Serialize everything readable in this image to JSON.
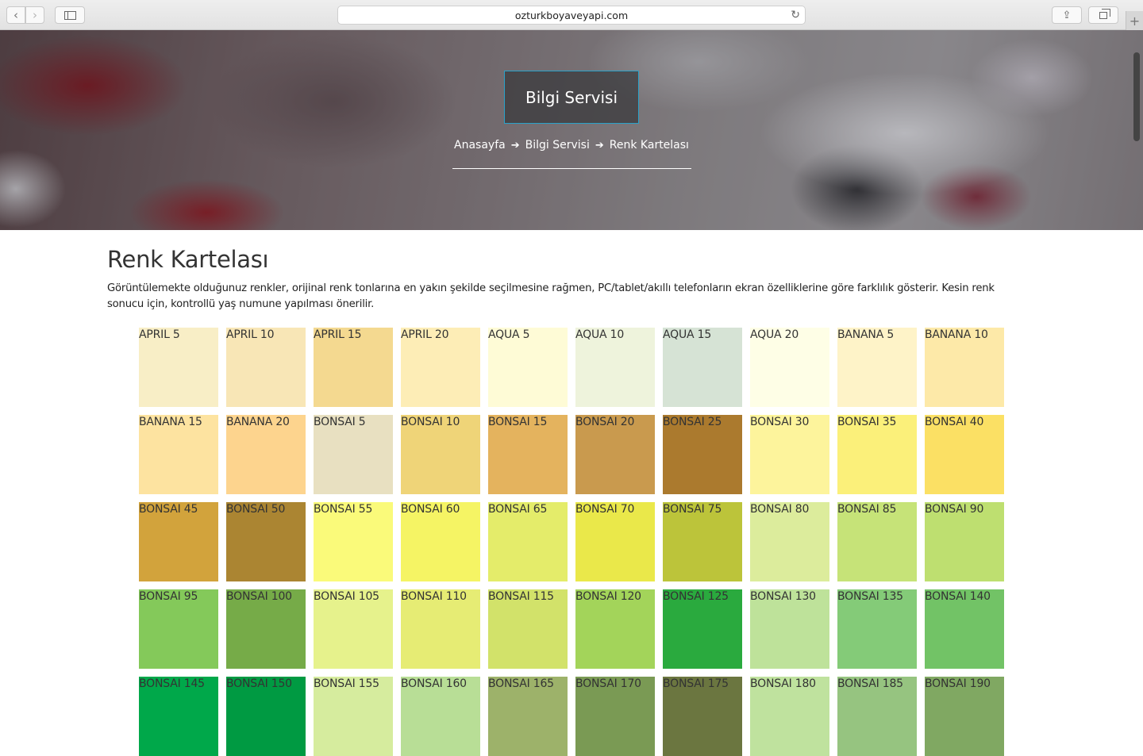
{
  "browser": {
    "url": "ozturkboyaveyapi.com",
    "back_icon": "‹",
    "forward_icon": "›",
    "reload_icon": "↻",
    "share_icon": "⇪",
    "newtab_icon": "+"
  },
  "hero": {
    "title": "Bilgi Servisi",
    "breadcrumb": [
      {
        "label": "Anasayfa"
      },
      {
        "label": "Bilgi Servisi"
      },
      {
        "label": "Renk Kartelası"
      }
    ],
    "separator": "➔"
  },
  "content": {
    "title": "Renk Kartelası",
    "description": "Görüntülemekte olduğunuz renkler, orijinal renk tonlarına en yakın şekilde seçilmesine rağmen, PC/tablet/akıllı telefonların ekran özelliklerine göre farklılık gösterir. Kesin renk sonucu için, kontrollü yaş numune yapılması önerilir."
  },
  "colors": [
    {
      "name": "APRIL 5",
      "hex": "#f8eec6"
    },
    {
      "name": "APRIL 10",
      "hex": "#f8e6b6"
    },
    {
      "name": "APRIL 15",
      "hex": "#f4d990"
    },
    {
      "name": "APRIL 20",
      "hex": "#fdedb6"
    },
    {
      "name": "AQUA 5",
      "hex": "#fefbd6"
    },
    {
      "name": "AQUA 10",
      "hex": "#eef3dc"
    },
    {
      "name": "AQUA 15",
      "hex": "#d6e3d5"
    },
    {
      "name": "AQUA 20",
      "hex": "#fefee6"
    },
    {
      "name": "BANANA 5",
      "hex": "#fef3c8"
    },
    {
      "name": "BANANA 10",
      "hex": "#fde9a8"
    },
    {
      "name": "BANANA 15",
      "hex": "#fde3a0"
    },
    {
      "name": "BANANA 20",
      "hex": "#fdd48e"
    },
    {
      "name": "BONSAI 5",
      "hex": "#e8e0c1"
    },
    {
      "name": "BONSAI 10",
      "hex": "#efd478"
    },
    {
      "name": "BONSAI 15",
      "hex": "#e4b35e"
    },
    {
      "name": "BONSAI 20",
      "hex": "#c99a4e"
    },
    {
      "name": "BONSAI 25",
      "hex": "#ab7a2e"
    },
    {
      "name": "BONSAI 30",
      "hex": "#fdf49c"
    },
    {
      "name": "BONSAI 35",
      "hex": "#fbf07a"
    },
    {
      "name": "BONSAI 40",
      "hex": "#fbe064"
    },
    {
      "name": "BONSAI 45",
      "hex": "#d2a33c"
    },
    {
      "name": "BONSAI 50",
      "hex": "#ab8532"
    },
    {
      "name": "BONSAI 55",
      "hex": "#fafa7a"
    },
    {
      "name": "BONSAI 60",
      "hex": "#f5f464"
    },
    {
      "name": "BONSAI 65",
      "hex": "#e4ec6a"
    },
    {
      "name": "BONSAI 70",
      "hex": "#eae84a"
    },
    {
      "name": "BONSAI 75",
      "hex": "#bcc43a"
    },
    {
      "name": "BONSAI 80",
      "hex": "#dcec9c"
    },
    {
      "name": "BONSAI 85",
      "hex": "#c6e378"
    },
    {
      "name": "BONSAI 90",
      "hex": "#bedf70"
    },
    {
      "name": "BONSAI 95",
      "hex": "#84c95a"
    },
    {
      "name": "BONSAI 100",
      "hex": "#76ab48"
    },
    {
      "name": "BONSAI 105",
      "hex": "#e6f28c"
    },
    {
      "name": "BONSAI 110",
      "hex": "#e6ec74"
    },
    {
      "name": "BONSAI 115",
      "hex": "#d2e26a"
    },
    {
      "name": "BONSAI 120",
      "hex": "#a3d45a"
    },
    {
      "name": "BONSAI 125",
      "hex": "#2aaa3e"
    },
    {
      "name": "BONSAI 130",
      "hex": "#bee29a"
    },
    {
      "name": "BONSAI 135",
      "hex": "#84cb78"
    },
    {
      "name": "BONSAI 140",
      "hex": "#72c366"
    },
    {
      "name": "BONSAI 145",
      "hex": "#00a84a"
    },
    {
      "name": "BONSAI 150",
      "hex": "#009a42"
    },
    {
      "name": "BONSAI 155",
      "hex": "#d6ec9e"
    },
    {
      "name": "BONSAI 160",
      "hex": "#b8de96"
    },
    {
      "name": "BONSAI 165",
      "hex": "#9db26a"
    },
    {
      "name": "BONSAI 170",
      "hex": "#7a9a54"
    },
    {
      "name": "BONSAI 175",
      "hex": "#6b7640"
    },
    {
      "name": "BONSAI 180",
      "hex": "#bfe29e"
    },
    {
      "name": "BONSAI 185",
      "hex": "#96c480"
    },
    {
      "name": "BONSAI 190",
      "hex": "#80a862"
    }
  ]
}
